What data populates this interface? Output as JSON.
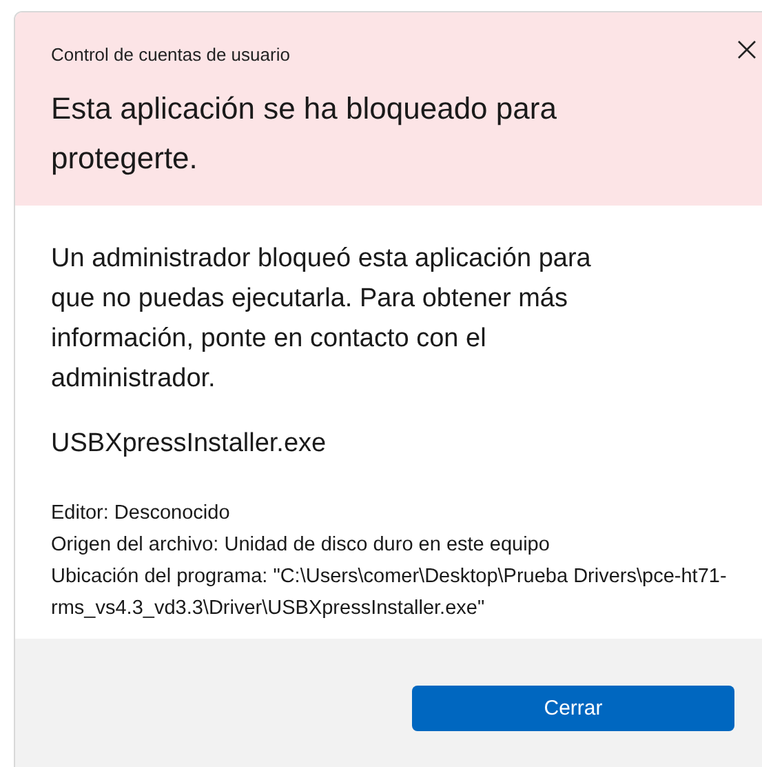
{
  "window": {
    "title": "Control de cuentas de usuario"
  },
  "heading": "Esta aplicación se ha bloqueado para protegerte.",
  "message": "Un administrador bloqueó esta aplicación para que no puedas ejecutarla. Para obtener más información, ponte en contacto con el administrador.",
  "file_name": "USBXpressInstaller.exe",
  "details": [
    "Editor: Desconocido",
    "Origen del archivo: Unidad de disco duro en este equipo",
    "Ubicación del programa: \"C:\\Users\\comer\\Desktop\\Prueba Drivers\\pce-ht71-rms_vs4.3_vd3.3\\Driver\\USBXpressInstaller.exe\""
  ],
  "buttons": [
    "Cerrar"
  ]
}
